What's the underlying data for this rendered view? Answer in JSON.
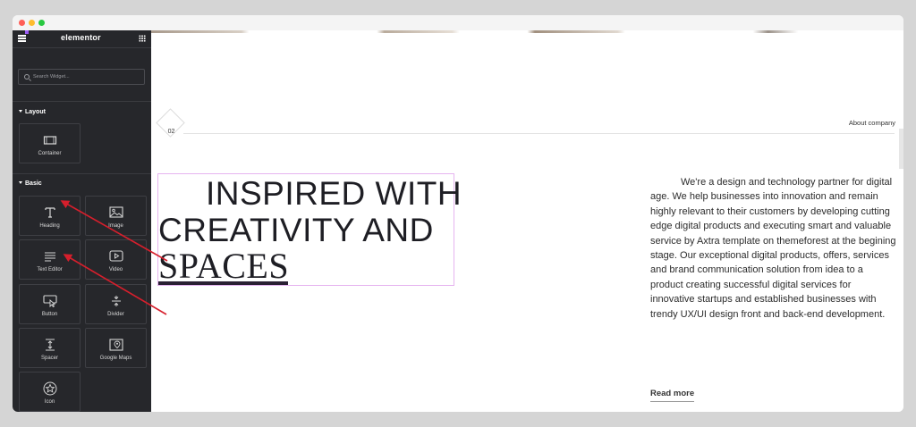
{
  "sidebar": {
    "logo": "elementor",
    "search_placeholder": "Search Widget...",
    "sections": [
      {
        "label": "Layout"
      },
      {
        "label": "Basic"
      }
    ],
    "widgets": {
      "container": "Container",
      "heading": "Heading",
      "image": "Image",
      "text_editor": "Text Editor",
      "video": "Video",
      "button": "Button",
      "divider": "Divider",
      "spacer": "Spacer",
      "google_maps": "Google Maps",
      "icon": "Icon"
    }
  },
  "canvas": {
    "section_number": "02",
    "about_label": "About company",
    "heading": {
      "line1": "INSPIRED WITH",
      "line2": "CREATIVITY AND",
      "line3": "SPACES"
    },
    "paragraph": "We're a design and technology partner for digital age. We help businesses into innovation and remain highly relevant to their customers by developing cutting edge digital products and executing smart and valuable service by Axtra template on themeforest at the begining stage. Our exceptional digital products, offers, services and brand communication solution from idea to a product creating successful digital services for innovative startups and established businesses with trendy UX/UI design front and back-end development.",
    "read_more": "Read more"
  },
  "colors": {
    "sidebar_bg": "#26272b",
    "accent_purple": "#9b5bf5",
    "annotation_arrow": "#d61f2c",
    "selection_outline": "#e6b4f0"
  }
}
